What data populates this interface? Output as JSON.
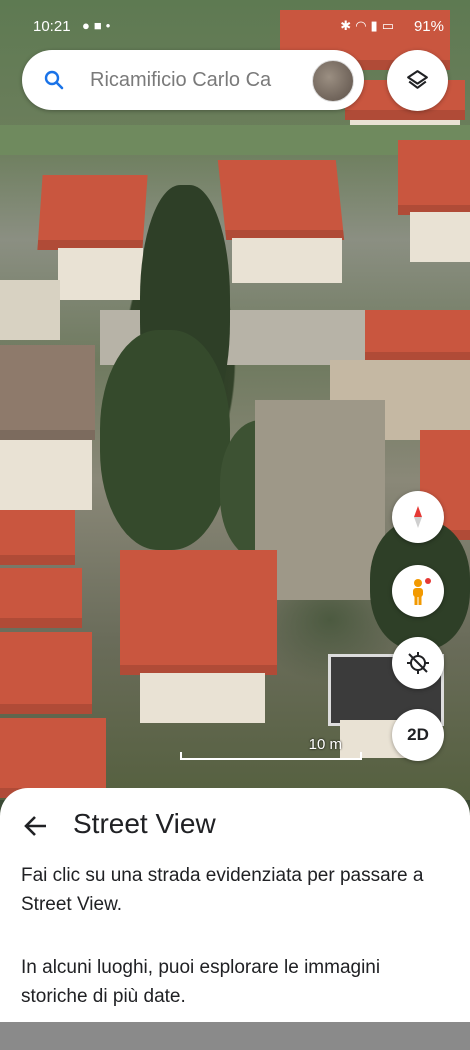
{
  "status_bar": {
    "time": "10:21",
    "battery": "91%"
  },
  "search": {
    "value": "Ricamificio Carlo Ca"
  },
  "map": {
    "scale_label": "10 m",
    "view_mode_button": "2D"
  },
  "sheet": {
    "title": "Street View",
    "paragraph1": "Fai clic su una strada evidenziata per passare a Street View.",
    "paragraph2": "In alcuni luoghi, puoi esplorare le immagini storiche di più date."
  },
  "icons": {
    "search": "search-icon",
    "avatar": "avatar",
    "layers": "layers-icon",
    "compass": "compass-icon",
    "pegman": "pegman-icon",
    "recenter": "recenter-off-icon",
    "back": "arrow-back-icon"
  },
  "colors": {
    "roof": "#c9563f",
    "sheet_bg": "#ffffff",
    "compass_red": "#e53935",
    "pegman": "#f29900"
  }
}
